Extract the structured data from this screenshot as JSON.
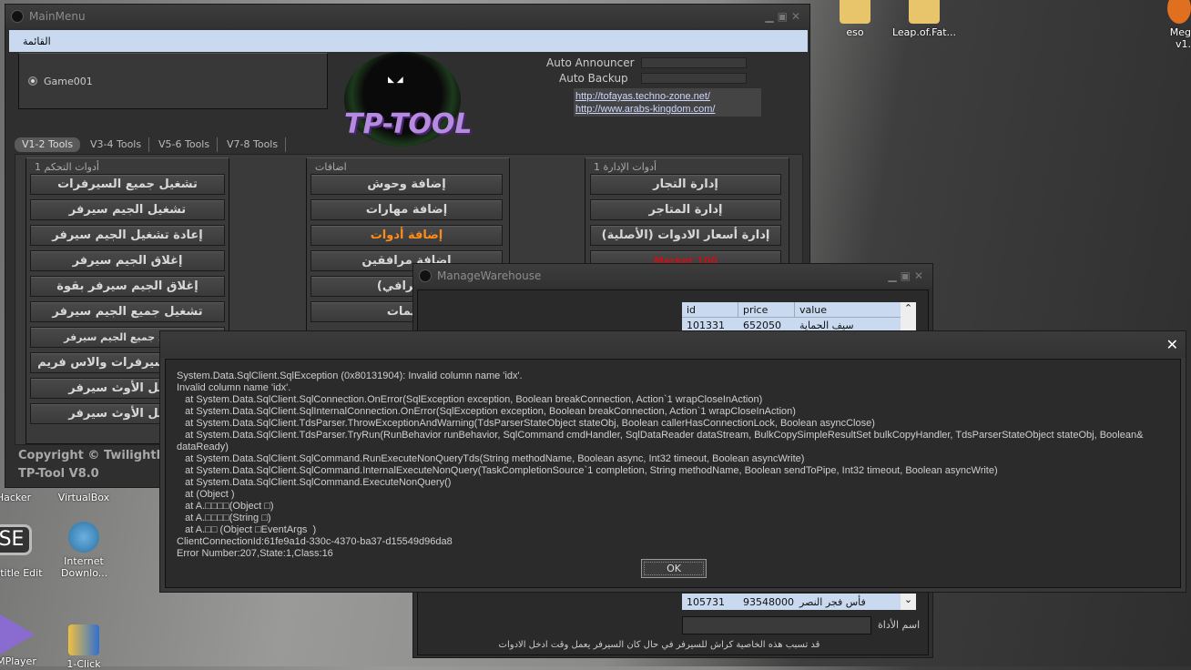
{
  "desktop": {
    "icons": [
      {
        "label": "eso"
      },
      {
        "label": "Leap.of.Fat..."
      },
      {
        "label": "Meg v1."
      },
      {
        "label": "Hacker"
      },
      {
        "label": "VirtualBox"
      },
      {
        "label": "otitle Edit"
      },
      {
        "label": "Internet Downlo..."
      },
      {
        "label": "MPlayer"
      },
      {
        "label": "1-Click"
      }
    ],
    "se_icon_text": "SE"
  },
  "main": {
    "title": "MainMenu",
    "menu": "القائمة",
    "server": "Game001",
    "auto_announcer": "Auto Announcer",
    "auto_backup": "Auto Backup",
    "links": [
      "http://tofayas.techno-zone.net/",
      "http://www.arabs-kingdom.com/"
    ],
    "logo": "TP-TOOL",
    "tabs": [
      "V1-2 Tools",
      "V3-4 Tools",
      "V5-6 Tools",
      "V7-8 Tools"
    ],
    "groups": [
      {
        "title": "أدوات التحكم 1",
        "buttons": [
          "تشغيل جميع السيرفرات",
          "تشغيل الجيم سيرفر",
          "إعادة تشغيل الجيم سيرفر",
          "إغلاق الجيم سيرفر",
          "إغلاق الجيم سيرفر بقوة",
          "تشغيل جميع الجيم سيرفر",
          "تشغيل جميع الجيم سيرفر",
          "تشغيل السيرفرات والاس فريم",
          "تشغيل الأوث سيرفر",
          "تشغيل الأوث سيرفر"
        ]
      },
      {
        "title": "اضافات",
        "buttons": [
          "إضافة وحوش",
          "إضافة مهارات",
          "إضافة أدوات",
          "إضافة مرافقين",
          "(احترافي)",
          "مهمات"
        ]
      },
      {
        "title": "أدوات الإدارة 1",
        "buttons": [
          "إدارة التجار",
          "إدارة المتاجر",
          "إدارة أسعار الادوات (الأصلية)",
          "100 Market"
        ]
      }
    ],
    "copyright": "Copyright © TwilightPrin",
    "version": "TP-Tool V8.0"
  },
  "warehouse": {
    "title": "ManageWarehouse",
    "columns": [
      "id",
      "price",
      "value"
    ],
    "rows": [
      [
        "101331",
        "652050",
        "سيف الحماية"
      ],
      [
        "105731",
        "93548000",
        "فأس فجر النصر"
      ]
    ],
    "name_label": "اسم الأداة",
    "name_value": "",
    "warning": "قد تسبب هذه الخاصية كراش للسيرفر في حال كان السيرفر يعمل وقت ادخل الادوات"
  },
  "error": {
    "lines": [
      "System.Data.SqlClient.SqlException (0x80131904): Invalid column name 'idx'.",
      "Invalid column name 'idx'.",
      "   at System.Data.SqlClient.SqlConnection.OnError(SqlException exception, Boolean breakConnection, Action`1 wrapCloseInAction)",
      "   at System.Data.SqlClient.SqlInternalConnection.OnError(SqlException exception, Boolean breakConnection, Action`1 wrapCloseInAction)",
      "   at System.Data.SqlClient.TdsParser.ThrowExceptionAndWarning(TdsParserStateObject stateObj, Boolean callerHasConnectionLock, Boolean asyncClose)",
      "   at System.Data.SqlClient.TdsParser.TryRun(RunBehavior runBehavior, SqlCommand cmdHandler, SqlDataReader dataStream, BulkCopySimpleResultSet bulkCopyHandler, TdsParserStateObject stateObj, Boolean& dataReady)",
      "   at System.Data.SqlClient.SqlCommand.RunExecuteNonQueryTds(String methodName, Boolean async, Int32 timeout, Boolean asyncWrite)",
      "   at System.Data.SqlClient.SqlCommand.InternalExecuteNonQuery(TaskCompletionSource`1 completion, String methodName, Boolean sendToPipe, Int32 timeout, Boolean asyncWrite)",
      "   at System.Data.SqlClient.SqlCommand.ExecuteNonQuery()",
      "   at (Object )",
      "   at A.□□□□(Object □)",
      "   at A.□□□□(String □)",
      "   at A.□□ (Object □EventArgs  )",
      "ClientConnectionId:61fe9a1d-330c-4370-ba37-d15549d96da8",
      "Error Number:207,State:1,Class:16"
    ],
    "ok": "OK"
  },
  "colors": {
    "accent_orange": "#ff8c1a",
    "market_red": "#c0141b",
    "menu_bar": "#c9daf0"
  }
}
